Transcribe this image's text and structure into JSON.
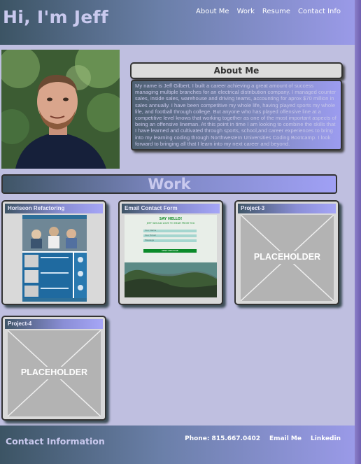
{
  "header": {
    "title": "Hi, I'm Jeff",
    "nav": [
      "About Me",
      "Work",
      "Resume",
      "Contact Info"
    ]
  },
  "about": {
    "heading": "About Me",
    "body": "My name is Jeff Gilbert, I built a career achieving a great amount of success managing multiple branches for an electrical distribution company. I managed counter sales, inside sales, warehouse and driving teams, accounting for aprox $70 million in sales annually. I have been competitive my whole life, having played sports my whole life, and football through college. But anyone who has played offensive line at a competitive level knows that working together as one of the most important aspects of being an offensive lineman. At this point in time I am looking to combine the skills that I have learned and cultivated through sports, school,and career experiences to bring into my learning coding through Northwestern Universities Coding Bootcamp. I look forward to bringing all that I learn into my next career and beyond."
  },
  "work": {
    "heading": "Work",
    "projects": [
      {
        "title": "Horiseon Refactoring"
      },
      {
        "title": "Email Contact Form",
        "screen_heading": "SAY HELLO!",
        "screen_subheading": "JEFF WOULD LOVE TO HEAR FROM YOU",
        "screen_fields": [
          "Your Name",
          "Your Email",
          "Message"
        ],
        "screen_button": "SEND MESSAGE"
      },
      {
        "title": "Project-3",
        "placeholder": "PLACEHOLDER"
      },
      {
        "title": "Project-4",
        "placeholder": "PLACEHOLDER"
      }
    ]
  },
  "footer": {
    "title": "Contact Information",
    "links": [
      "Phone: 815.667.0402",
      "Email Me",
      "Linkedin"
    ]
  },
  "colors": {
    "background": "#bfbfe0",
    "header_gradient_start": "#3c5464",
    "header_gradient_end": "#9a9ae8",
    "title_text": "#c9c9ee"
  }
}
